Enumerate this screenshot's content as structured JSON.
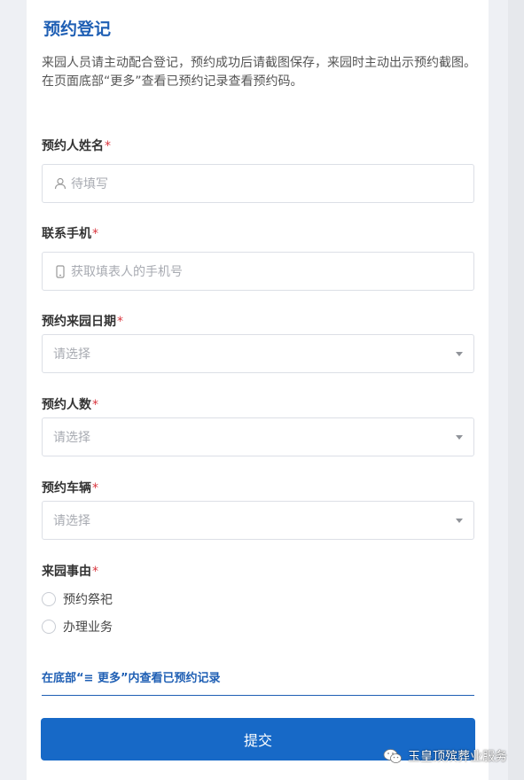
{
  "form": {
    "title": "预约登记",
    "intro_line1": "来园人员请主动配合登记，预约成功后请截图保存，来园时主动出示预约截图。",
    "intro_line2": "在页面底部“更多”查看已预约记录查看预约码。",
    "required_mark": "*"
  },
  "fields": {
    "name": {
      "label": "预约人姓名",
      "placeholder": "待填写",
      "icon": "user-icon"
    },
    "phone": {
      "label": "联系手机",
      "placeholder": "获取填表人的手机号",
      "icon": "phone-icon"
    },
    "date": {
      "label": "预约来园日期",
      "placeholder": "请选择"
    },
    "count": {
      "label": "预约人数",
      "placeholder": "请选择"
    },
    "vehicle": {
      "label": "预约车辆",
      "placeholder": "请选择"
    },
    "reason": {
      "label": "来园事由",
      "options": [
        "预约祭祀",
        "办理业务"
      ]
    }
  },
  "footer": {
    "records_link": "在底部“≡ 更多”内查看已预约记录",
    "submit_label": "提交"
  },
  "watermark": {
    "text": "玉皇顶殡葬业服务",
    "icon": "wechat-icon"
  },
  "colors": {
    "accent": "#1f5fb4",
    "button": "#1769c7",
    "required": "#d9363e"
  }
}
